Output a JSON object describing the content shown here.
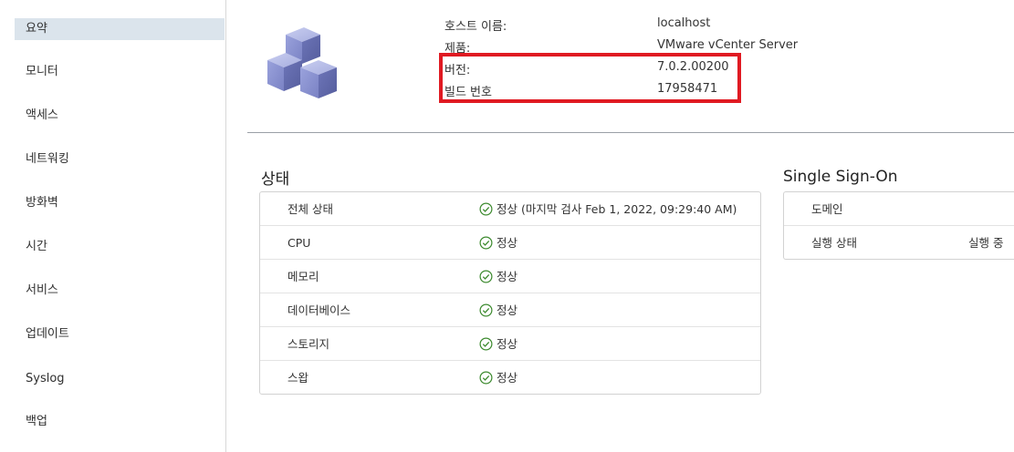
{
  "sidebar": {
    "items": [
      {
        "label": "요약",
        "active": true
      },
      {
        "label": "모니터"
      },
      {
        "label": "액세스"
      },
      {
        "label": "네트워킹"
      },
      {
        "label": "방화벽"
      },
      {
        "label": "시간"
      },
      {
        "label": "서비스"
      },
      {
        "label": "업데이트"
      },
      {
        "label": "Syslog"
      },
      {
        "label": "백업"
      }
    ]
  },
  "summary": {
    "rows": [
      {
        "label": "호스트 이름:",
        "value": "localhost"
      },
      {
        "label": "제품:",
        "value": "VMware vCenter Server"
      },
      {
        "label": "버전:",
        "value": "7.0.2.00200"
      },
      {
        "label": "빌드 번호",
        "value": "17958471"
      }
    ],
    "highlight_color": "#e01a22"
  },
  "health": {
    "title": "상태",
    "rows": [
      {
        "label": "전체 상태",
        "value": "정상 (마지막 검사 Feb 1, 2022, 09:29:40 AM)"
      },
      {
        "label": "CPU",
        "value": "정상"
      },
      {
        "label": "메모리",
        "value": "정상"
      },
      {
        "label": "데이터베이스",
        "value": "정상"
      },
      {
        "label": "스토리지",
        "value": "정상"
      },
      {
        "label": "스왑",
        "value": "정상"
      }
    ],
    "ok_color": "#3c8a2e"
  },
  "sso": {
    "title": "Single Sign-On",
    "rows": [
      {
        "label": "도메인",
        "value": ""
      },
      {
        "label": "실행 상태",
        "value": "실행 중"
      }
    ]
  }
}
